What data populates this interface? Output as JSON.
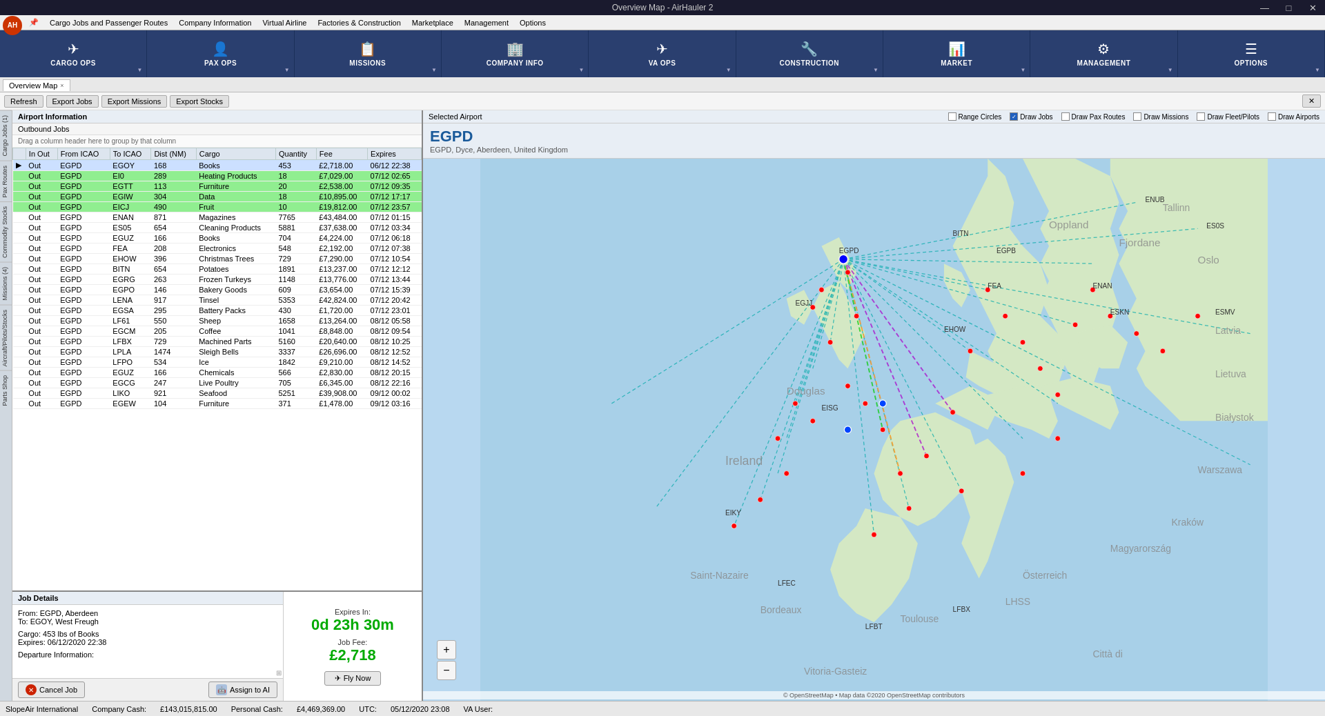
{
  "window": {
    "title": "Overview Map - AirHauler 2",
    "controls": [
      "—",
      "□",
      "✕"
    ]
  },
  "menubar": {
    "logo_text": "AH",
    "items": [
      "Cargo Jobs and Passenger Routes",
      "Company Information",
      "Virtual Airline",
      "Factories & Construction",
      "Marketplace",
      "Management",
      "Options"
    ]
  },
  "top_buttons": [
    {
      "id": "cargo-ops",
      "label": "CARGO OPS",
      "icon": "✈",
      "active": false
    },
    {
      "id": "pax-ops",
      "label": "PAX OPS",
      "icon": "👤",
      "active": false
    },
    {
      "id": "missions",
      "label": "MISSIONS",
      "icon": "📋",
      "active": false
    },
    {
      "id": "company-info",
      "label": "COMPANY INFO",
      "icon": "🏢",
      "active": false
    },
    {
      "id": "va-ops",
      "label": "VA OPS",
      "icon": "✈",
      "active": false
    },
    {
      "id": "construction",
      "label": "CONSTRUCTION",
      "icon": "🔧",
      "active": false
    },
    {
      "id": "market",
      "label": "MARKET",
      "icon": "📊",
      "active": false
    },
    {
      "id": "management",
      "label": "MANAGEMENT",
      "icon": "⚙",
      "active": false
    },
    {
      "id": "options",
      "label": "OPTIONS",
      "icon": "☰",
      "active": false
    }
  ],
  "tab": {
    "label": "Overview Map",
    "close": "×"
  },
  "toolbar": {
    "refresh": "Refresh",
    "export_jobs": "Export Jobs",
    "export_missions": "Export Missions",
    "export_stocks": "Export Stocks",
    "close_icon": "✕"
  },
  "sidebar_tabs": [
    "Cargo Jobs (1)",
    "Pax Routes",
    "Commodity Stocks",
    "Missions (4)",
    "Aircraft/Pilots/Stocks",
    "Parts Shop"
  ],
  "left_panel": {
    "airport_info_label": "Airport Information",
    "outbound_jobs_label": "Outbound Jobs",
    "drag_hint": "Drag a column header here to group by that column",
    "table": {
      "columns": [
        "In Out",
        "From ICAO",
        "To ICAO",
        "Dist (NM)",
        "Cargo",
        "Quantity",
        "Fee",
        "Expires"
      ],
      "rows": [
        {
          "inout": "Out",
          "from": "EGPD",
          "to": "EGOY",
          "dist": 168,
          "cargo": "Books",
          "qty": 453,
          "fee": "£2,718.00",
          "expires": "06/12 22:38",
          "highlight": "selected"
        },
        {
          "inout": "Out",
          "from": "EGPD",
          "to": "EI0",
          "dist": 289,
          "cargo": "Heating Products",
          "qty": 18,
          "fee": "£7,029.00",
          "expires": "07/12 02:65",
          "highlight": "green"
        },
        {
          "inout": "Out",
          "from": "EGPD",
          "to": "EGTT",
          "dist": 113,
          "cargo": "Furniture",
          "qty": 20,
          "fee": "£2,538.00",
          "expires": "07/12 09:35",
          "highlight": "green"
        },
        {
          "inout": "Out",
          "from": "EGPD",
          "to": "EGIW",
          "dist": 304,
          "cargo": "Data",
          "qty": 18,
          "fee": "£10,895.00",
          "expires": "07/12 17:17",
          "highlight": "green"
        },
        {
          "inout": "Out",
          "from": "EGPD",
          "to": "EICJ",
          "dist": 490,
          "cargo": "Fruit",
          "qty": 10,
          "fee": "£19,812.00",
          "expires": "07/12 23:57",
          "highlight": "green"
        },
        {
          "inout": "Out",
          "from": "EGPD",
          "to": "ENAN",
          "dist": 871,
          "cargo": "Magazines",
          "qty": 7765,
          "fee": "£43,484.00",
          "expires": "07/12 01:15",
          "highlight": "none"
        },
        {
          "inout": "Out",
          "from": "EGPD",
          "to": "ES05",
          "dist": 654,
          "cargo": "Cleaning Products",
          "qty": 5881,
          "fee": "£37,638.00",
          "expires": "07/12 03:34",
          "highlight": "none"
        },
        {
          "inout": "Out",
          "from": "EGPD",
          "to": "EGUZ",
          "dist": 166,
          "cargo": "Books",
          "qty": 704,
          "fee": "£4,224.00",
          "expires": "07/12 06:18",
          "highlight": "none"
        },
        {
          "inout": "Out",
          "from": "EGPD",
          "to": "FEA",
          "dist": 208,
          "cargo": "Electronics",
          "qty": 548,
          "fee": "£2,192.00",
          "expires": "07/12 07:38",
          "highlight": "none"
        },
        {
          "inout": "Out",
          "from": "EGPD",
          "to": "EHOW",
          "dist": 396,
          "cargo": "Christmas Trees",
          "qty": 729,
          "fee": "£7,290.00",
          "expires": "07/12 10:54",
          "highlight": "none"
        },
        {
          "inout": "Out",
          "from": "EGPD",
          "to": "BITN",
          "dist": 654,
          "cargo": "Potatoes",
          "qty": 1891,
          "fee": "£13,237.00",
          "expires": "07/12 12:12",
          "highlight": "none"
        },
        {
          "inout": "Out",
          "from": "EGPD",
          "to": "EGRG",
          "dist": 263,
          "cargo": "Frozen Turkeys",
          "qty": 1148,
          "fee": "£13,776.00",
          "expires": "07/12 13:44",
          "highlight": "none"
        },
        {
          "inout": "Out",
          "from": "EGPD",
          "to": "EGPO",
          "dist": 146,
          "cargo": "Bakery Goods",
          "qty": 609,
          "fee": "£3,654.00",
          "expires": "07/12 15:39",
          "highlight": "none"
        },
        {
          "inout": "Out",
          "from": "EGPD",
          "to": "LENA",
          "dist": 917,
          "cargo": "Tinsel",
          "qty": 5353,
          "fee": "£42,824.00",
          "expires": "07/12 20:42",
          "highlight": "none"
        },
        {
          "inout": "Out",
          "from": "EGPD",
          "to": "EGSA",
          "dist": 295,
          "cargo": "Battery Packs",
          "qty": 430,
          "fee": "£1,720.00",
          "expires": "07/12 23:01",
          "highlight": "none"
        },
        {
          "inout": "Out",
          "from": "EGPD",
          "to": "LF61",
          "dist": 550,
          "cargo": "Sheep",
          "qty": 1658,
          "fee": "£13,264.00",
          "expires": "08/12 05:58",
          "highlight": "none"
        },
        {
          "inout": "Out",
          "from": "EGPD",
          "to": "EGCM",
          "dist": 205,
          "cargo": "Coffee",
          "qty": 1041,
          "fee": "£8,848.00",
          "expires": "08/12 09:54",
          "highlight": "none"
        },
        {
          "inout": "Out",
          "from": "EGPD",
          "to": "LFBX",
          "dist": 729,
          "cargo": "Machined Parts",
          "qty": 5160,
          "fee": "£20,640.00",
          "expires": "08/12 10:25",
          "highlight": "none"
        },
        {
          "inout": "Out",
          "from": "EGPD",
          "to": "LPLA",
          "dist": 1474,
          "cargo": "Sleigh Bells",
          "qty": 3337,
          "fee": "£26,696.00",
          "expires": "08/12 12:52",
          "highlight": "none"
        },
        {
          "inout": "Out",
          "from": "EGPD",
          "to": "LFPO",
          "dist": 534,
          "cargo": "Ice",
          "qty": 1842,
          "fee": "£9,210.00",
          "expires": "08/12 14:52",
          "highlight": "none"
        },
        {
          "inout": "Out",
          "from": "EGPD",
          "to": "EGUZ",
          "dist": 166,
          "cargo": "Chemicals",
          "qty": 566,
          "fee": "£2,830.00",
          "expires": "08/12 20:15",
          "highlight": "none"
        },
        {
          "inout": "Out",
          "from": "EGPD",
          "to": "EGCG",
          "dist": 247,
          "cargo": "Live Poultry",
          "qty": 705,
          "fee": "£6,345.00",
          "expires": "08/12 22:16",
          "highlight": "none"
        },
        {
          "inout": "Out",
          "from": "EGPD",
          "to": "LIKO",
          "dist": 921,
          "cargo": "Seafood",
          "qty": 5251,
          "fee": "£39,908.00",
          "expires": "09/12 00:02",
          "highlight": "none"
        },
        {
          "inout": "Out",
          "from": "EGPD",
          "to": "EGEW",
          "dist": 104,
          "cargo": "Furniture",
          "qty": 371,
          "fee": "£1,478.00",
          "expires": "09/12 03:16",
          "highlight": "none"
        }
      ]
    }
  },
  "job_details": {
    "header": "Job Details",
    "from": "From: EGPD, Aberdeen",
    "to": "To: EGOY, West Freugh",
    "cargo": "Cargo: 453 lbs of Books",
    "expires": "Expires: 06/12/2020 22:38",
    "departure": "Departure Information:",
    "expires_in_label": "Expires In:",
    "expires_in_value": "0d 23h 30m",
    "job_fee_label": "Job Fee:",
    "job_fee_value": "£2,718",
    "cancel_btn": "Cancel Job",
    "assign_btn": "Assign to AI",
    "fly_now_btn": "Fly Now"
  },
  "map": {
    "selected_airport_label": "Selected Airport",
    "airport_code": "EGPD",
    "airport_full": "EGPD, Dyce, Aberdeen, United Kingdom",
    "options": {
      "range_circles": {
        "label": "Range Circles",
        "checked": false
      },
      "draw_jobs": {
        "label": "Draw Jobs",
        "checked": true
      },
      "draw_pax_routes": {
        "label": "Draw Pax Routes",
        "checked": false
      },
      "draw_missions": {
        "label": "Draw Missions",
        "checked": false
      },
      "draw_fleet_pilots": {
        "label": "Draw Fleet/Pilots",
        "checked": false
      },
      "draw_airports": {
        "label": "Draw Airports",
        "checked": false
      }
    },
    "attribution": "© OpenStreetMap • Map data ©2020 OpenStreetMap contributors",
    "zoom_in": "+",
    "zoom_out": "−"
  },
  "status_bar": {
    "company": "SlopeAir International",
    "company_cash_label": "Company Cash:",
    "company_cash": "£143,015,815.00",
    "personal_cash_label": "Personal Cash:",
    "personal_cash": "£4,469,369.00",
    "utc_label": "UTC:",
    "utc": "05/12/2020 23:08",
    "va_label": "VA User:"
  }
}
